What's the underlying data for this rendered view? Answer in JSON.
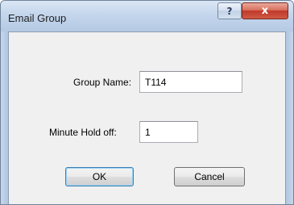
{
  "window": {
    "title": "Email Group"
  },
  "titlebar": {
    "help_glyph": "?",
    "close_glyph": "x"
  },
  "form": {
    "group_name": {
      "label": "Group Name:",
      "value": "T114"
    },
    "minute_hold_off": {
      "label": "Minute Hold off:",
      "value": "1"
    }
  },
  "buttons": {
    "ok_label": "OK",
    "cancel_label": "Cancel"
  },
  "colors": {
    "titlebar": "#c4d6ec",
    "client_background": "#f0f0f0",
    "close_button": "#c0392b",
    "default_button_border": "#3c7fb1"
  },
  "icons": {
    "help": "help-icon",
    "close": "close-icon"
  }
}
